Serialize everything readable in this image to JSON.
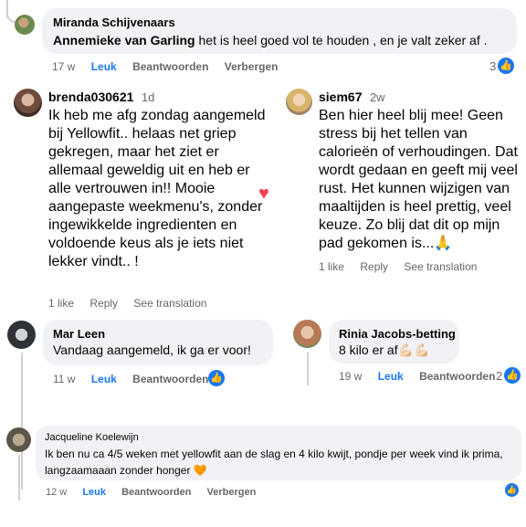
{
  "comments": {
    "miranda": {
      "name": "Miranda Schijvenaars",
      "mention": "Annemieke van Garling",
      "text": " het is heel goed vol te houden , en je valt zeker af .",
      "time": "17 w",
      "like": "Leuk",
      "reply": "Beantwoorden",
      "hide": "Verbergen",
      "reactions": "3"
    },
    "brenda": {
      "name": "brenda030621",
      "time_inline": "1d",
      "text": "Ik heb me afg zondag aangemeld bij Yellowfit.. helaas net griep gekregen, maar het ziet er allemaal geweldig uit en heb er alle vertrouwen in!! Mooie aangepaste weekmenu's, zonder ingewikkelde ingredienten en voldoende keus als je iets niet lekker vindt.. !",
      "likes": "1 like",
      "reply": "Reply",
      "translate": "See translation"
    },
    "siem": {
      "name": "siem67",
      "time_inline": "2w",
      "text": "Ben hier heel blij mee! Geen stress bij het tellen van calorieën of verhoudingen. Dat wordt gedaan en geeft mij veel rust. Het kunnen wijzigen van maaltijden is heel prettig, veel keuze. Zo blij dat dit op mijn pad gekomen is...🙏",
      "likes": "1 like",
      "reply": "Reply",
      "translate": "See translation"
    },
    "marleen": {
      "name": "Mar Leen",
      "text": "Vandaag aangemeld, ik ga er voor!",
      "time": "11 w",
      "like": "Leuk",
      "reply": "Beantwoorden"
    },
    "rinia": {
      "name": "Rinia Jacobs-betting",
      "text": "8 kilo er af💪🏻💪🏻",
      "time": "19 w",
      "like": "Leuk",
      "reply": "Beantwoorden",
      "reactions": "2"
    },
    "jacqueline": {
      "name": "Jacqueline Koelewijn",
      "text": "Ik ben nu ca 4/5 weken met yellowfit aan de slag en 4 kilo kwijt, pondje per week vind ik prima, langzaamaaan zonder honger 🧡",
      "time": "12 w",
      "like": "Leuk",
      "reply": "Beantwoorden",
      "hide": "Verbergen"
    }
  },
  "icons": {
    "like": "👍",
    "heart": "♥"
  },
  "colors": {
    "bubble": "#f0f2f5",
    "link_blue": "#1877f2",
    "meta_gray": "#65676b",
    "heart_red": "#f33e58"
  }
}
